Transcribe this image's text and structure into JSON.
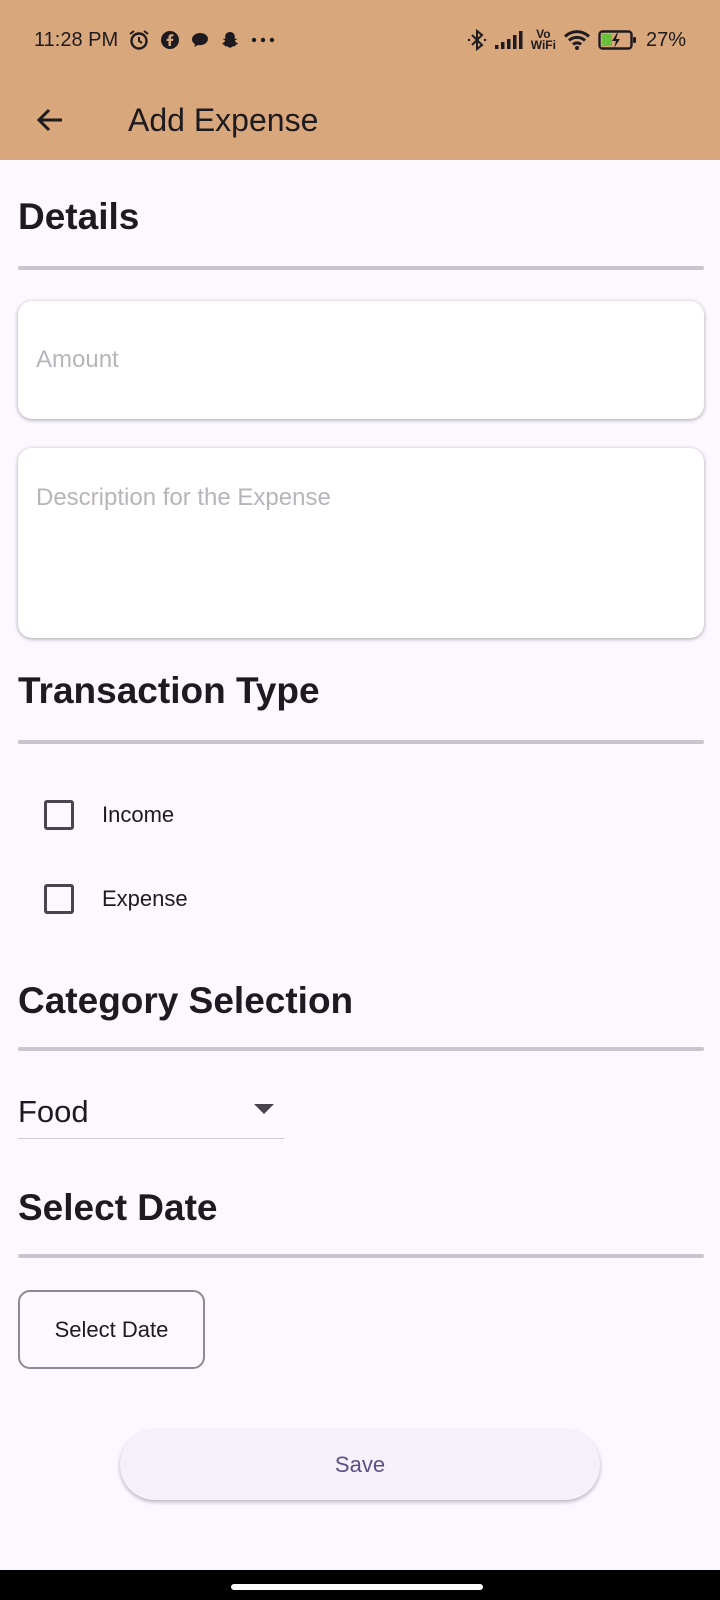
{
  "status_bar": {
    "time": "11:28 PM",
    "wifi_label_top": "Vo",
    "wifi_label_bottom": "WiFi",
    "battery": "27%"
  },
  "app_bar": {
    "title": "Add Expense",
    "color": "#d9a77c"
  },
  "details": {
    "title": "Details",
    "amount": {
      "value": "",
      "placeholder": "Amount"
    },
    "description": {
      "value": "",
      "placeholder": "Description for the Expense"
    }
  },
  "transaction_type": {
    "title": "Transaction Type",
    "options": [
      {
        "label": "Income",
        "checked": false
      },
      {
        "label": "Expense",
        "checked": false
      }
    ]
  },
  "category": {
    "title": "Category Selection",
    "selected": "Food"
  },
  "date": {
    "title": "Select Date",
    "button_label": "Select Date"
  },
  "save_label": "Save"
}
